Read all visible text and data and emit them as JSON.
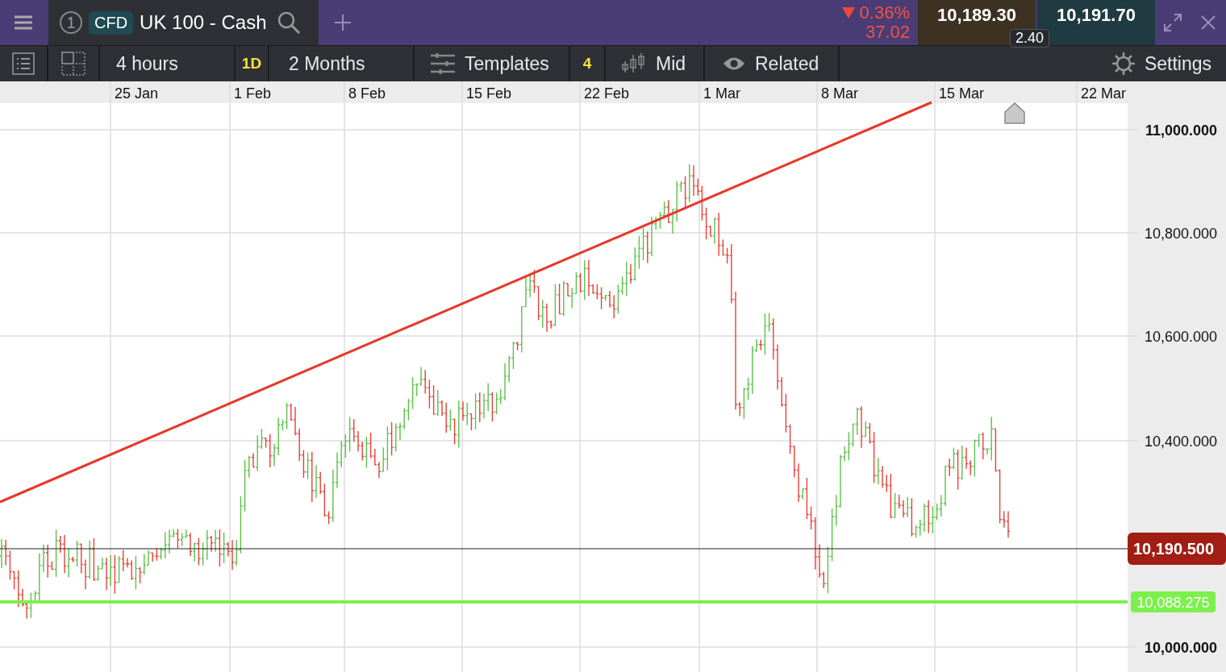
{
  "header": {
    "tab": {
      "number": "1",
      "badge": "CFD",
      "title": "UK 100 - Cash"
    },
    "change": {
      "falling": true,
      "percent": "0.36%",
      "points": "37.02"
    },
    "sell_price": "10,189.30",
    "buy_price": "10,191.70",
    "spread": "2.40"
  },
  "toolbar": {
    "interval": "4 hours",
    "period_badge": "1D",
    "range": "2 Months",
    "templates": "Templates",
    "templates_count": "4",
    "price_type": "Mid",
    "related": "Related",
    "settings": "Settings"
  },
  "chart": {
    "dates": [
      "25 Jan",
      "1 Feb",
      "8 Feb",
      "15 Feb",
      "22 Feb",
      "1 Mar",
      "8 Mar",
      "15 Mar",
      "22 Mar"
    ],
    "price_ticks": [
      {
        "label": "11,000.000",
        "major": true
      },
      {
        "label": "10,800.000",
        "major": false
      },
      {
        "label": "10,600.000",
        "major": false
      },
      {
        "label": "10,400.000",
        "major": false
      },
      {
        "label": "10,000.000",
        "major": true
      }
    ],
    "current_price": "10,190.500",
    "level_line": "10,088.275"
  }
}
